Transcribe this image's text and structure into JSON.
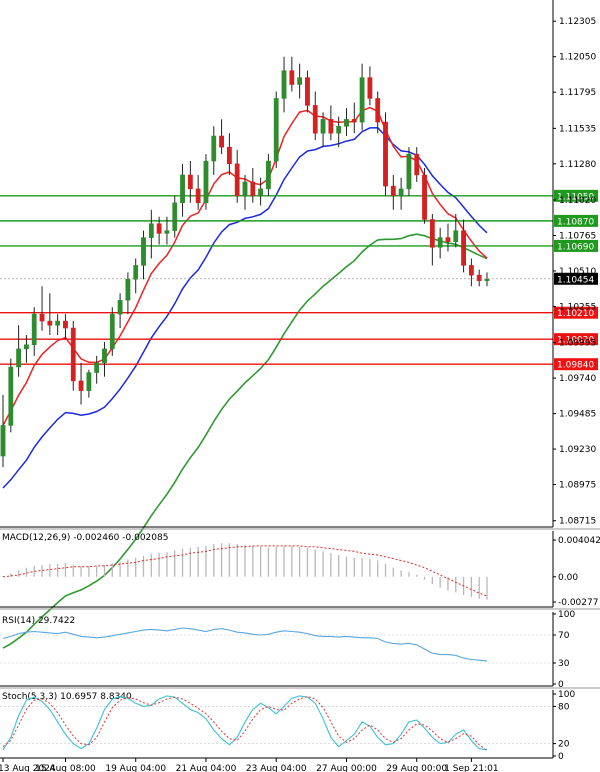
{
  "colors": {
    "bull": "#2e8b2e",
    "bear": "#d42020",
    "ma_red": "#ee2222",
    "ma_blue": "#1a2ae0",
    "ma_green": "#2f9a2f",
    "support": "#ee1111",
    "resistance": "#1f9a1f",
    "price_marker": "#000000",
    "macd_signal": "#ee2222",
    "macd_hist": "#b8b8b8",
    "rsi": "#5aa7e0",
    "stoch_main": "#3cc0d6",
    "stoch_signal": "#e33333"
  },
  "chart_data": [
    {
      "type": "candlestick",
      "pane": "price",
      "y_ticks": [
        "1.12305",
        "1.12050",
        "1.11795",
        "1.11535",
        "1.11280",
        "1.11020",
        "1.10765",
        "1.10510",
        "1.10255",
        "1.09995",
        "1.09740",
        "1.09485",
        "1.09230",
        "1.08975",
        "1.08715"
      ],
      "ylim": [
        1.0867,
        1.124
      ],
      "x_tick_labels": [
        "13 Aug 2024",
        "15 Aug 08:00",
        "19 Aug 04:00",
        "21 Aug 04:00",
        "23 Aug 04:00",
        "27 Aug 00:00",
        "29 Aug 00:00",
        "1 Sep 21:01"
      ],
      "current_price": "1.10454",
      "resistance_levels": [
        "1.11050",
        "1.10870",
        "1.10690"
      ],
      "support_levels": [
        "1.10210",
        "1.10020",
        "1.09840"
      ],
      "ohlc": [
        [
          1.0918,
          1.0962,
          1.091,
          1.094
        ],
        [
          1.094,
          1.0988,
          1.0935,
          1.0982
        ],
        [
          1.0982,
          1.1012,
          1.0975,
          1.0995
        ],
        [
          1.0995,
          1.1005,
          1.0985,
          1.0998
        ],
        [
          1.0998,
          1.1025,
          1.099,
          1.102
        ],
        [
          1.102,
          1.104,
          1.1008,
          1.1015
        ],
        [
          1.1015,
          1.1035,
          1.1005,
          1.1012
        ],
        [
          1.1012,
          1.102,
          1.1005,
          1.1015
        ],
        [
          1.1015,
          1.102,
          1.1002,
          1.101
        ],
        [
          1.101,
          1.1015,
          1.0965,
          1.0972
        ],
        [
          1.0972,
          1.0985,
          1.0955,
          1.0965
        ],
        [
          1.0965,
          1.098,
          1.096,
          1.0978
        ],
        [
          1.0978,
          1.099,
          1.097,
          1.0985
        ],
        [
          1.0985,
          1.1,
          1.0975,
          1.0995
        ],
        [
          1.0995,
          1.1025,
          1.099,
          1.102
        ],
        [
          1.102,
          1.1035,
          1.101,
          1.103
        ],
        [
          1.103,
          1.105,
          1.102,
          1.1045
        ],
        [
          1.1045,
          1.106,
          1.1035,
          1.1055
        ],
        [
          1.1055,
          1.108,
          1.1045,
          1.1075
        ],
        [
          1.1075,
          1.1095,
          1.106,
          1.1085
        ],
        [
          1.1085,
          1.109,
          1.107,
          1.1078
        ],
        [
          1.1078,
          1.109,
          1.107,
          1.108
        ],
        [
          1.108,
          1.1105,
          1.1075,
          1.11
        ],
        [
          1.11,
          1.1128,
          1.109,
          1.112
        ],
        [
          1.112,
          1.113,
          1.11,
          1.111
        ],
        [
          1.111,
          1.112,
          1.1095,
          1.11
        ],
        [
          1.11,
          1.1135,
          1.1095,
          1.113
        ],
        [
          1.113,
          1.1155,
          1.112,
          1.1148
        ],
        [
          1.1148,
          1.116,
          1.1135,
          1.114
        ],
        [
          1.114,
          1.115,
          1.112,
          1.1128
        ],
        [
          1.1128,
          1.1138,
          1.11,
          1.1105
        ],
        [
          1.1105,
          1.112,
          1.1095,
          1.1115
        ],
        [
          1.1115,
          1.1125,
          1.11,
          1.1105
        ],
        [
          1.1105,
          1.1118,
          1.1098,
          1.111
        ],
        [
          1.111,
          1.1135,
          1.1105,
          1.113
        ],
        [
          1.113,
          1.118,
          1.1125,
          1.1175
        ],
        [
          1.1175,
          1.1205,
          1.1165,
          1.1195
        ],
        [
          1.1195,
          1.1205,
          1.118,
          1.1185
        ],
        [
          1.1185,
          1.12,
          1.1175,
          1.119
        ],
        [
          1.119,
          1.1195,
          1.1165,
          1.117
        ],
        [
          1.117,
          1.118,
          1.1145,
          1.115
        ],
        [
          1.115,
          1.1165,
          1.114,
          1.116
        ],
        [
          1.116,
          1.117,
          1.1145,
          1.115
        ],
        [
          1.115,
          1.1162,
          1.114,
          1.1155
        ],
        [
          1.1155,
          1.1168,
          1.1148,
          1.116
        ],
        [
          1.116,
          1.1172,
          1.115,
          1.1158
        ],
        [
          1.1158,
          1.12,
          1.1152,
          1.119
        ],
        [
          1.119,
          1.1198,
          1.117,
          1.1175
        ],
        [
          1.1175,
          1.118,
          1.115,
          1.1158
        ],
        [
          1.1158,
          1.1165,
          1.1105,
          1.1112
        ],
        [
          1.1112,
          1.112,
          1.1095,
          1.1105
        ],
        [
          1.1105,
          1.1118,
          1.1095,
          1.111
        ],
        [
          1.111,
          1.114,
          1.1105,
          1.1135
        ],
        [
          1.1135,
          1.114,
          1.1115,
          1.112
        ],
        [
          1.112,
          1.1125,
          1.1085,
          1.1088
        ],
        [
          1.1088,
          1.1092,
          1.1055,
          1.1068
        ],
        [
          1.1068,
          1.1082,
          1.106,
          1.1075
        ],
        [
          1.1075,
          1.1085,
          1.1065,
          1.1072
        ],
        [
          1.1072,
          1.1092,
          1.1068,
          1.108
        ],
        [
          1.108,
          1.1088,
          1.105,
          1.1055
        ],
        [
          1.1055,
          1.106,
          1.104,
          1.1048
        ],
        [
          1.1048,
          1.1052,
          1.104,
          1.1044
        ],
        [
          1.1044,
          1.105,
          1.104,
          1.1045
        ]
      ]
    },
    {
      "type": "line",
      "pane": "macd",
      "title": "MACD(12,26,9) -0.002460 -0.002085",
      "y_ticks": [
        "0.004042",
        "0.00",
        "-0.00277"
      ],
      "ylim": [
        -0.0031,
        0.0046
      ],
      "histogram": [
        0.0001,
        0.0004,
        0.0007,
        0.001,
        0.0012,
        0.0013,
        0.0014,
        0.0014,
        0.0015,
        0.0013,
        0.0012,
        0.0012,
        0.0012,
        0.0013,
        0.0015,
        0.0017,
        0.0019,
        0.0021,
        0.0023,
        0.0025,
        0.0026,
        0.0027,
        0.0029,
        0.0031,
        0.0032,
        0.0033,
        0.0034,
        0.0036,
        0.0037,
        0.0037,
        0.0036,
        0.0035,
        0.0034,
        0.0033,
        0.0032,
        0.0033,
        0.0034,
        0.0034,
        0.0033,
        0.0032,
        0.003,
        0.0028,
        0.0026,
        0.0024,
        0.0022,
        0.0021,
        0.0021,
        0.002,
        0.0018,
        0.0014,
        0.001,
        0.0007,
        0.0005,
        0.0002,
        -0.0003,
        -0.0008,
        -0.0012,
        -0.0015,
        -0.0017,
        -0.002,
        -0.0022,
        -0.0024,
        -0.0025
      ],
      "signal": [
        0.0,
        0.0001,
        0.0002,
        0.0004,
        0.0006,
        0.0007,
        0.0008,
        0.0009,
        0.001,
        0.0011,
        0.0011,
        0.0011,
        0.0012,
        0.0012,
        0.0013,
        0.0014,
        0.0015,
        0.0016,
        0.0018,
        0.0019,
        0.002,
        0.0022,
        0.0023,
        0.0024,
        0.0026,
        0.0027,
        0.0028,
        0.003,
        0.0031,
        0.0032,
        0.0033,
        0.0033,
        0.0034,
        0.0034,
        0.0034,
        0.0034,
        0.0034,
        0.0034,
        0.0034,
        0.0033,
        0.0033,
        0.0032,
        0.0031,
        0.003,
        0.0029,
        0.0028,
        0.0026,
        0.0025,
        0.0024,
        0.0022,
        0.002,
        0.0018,
        0.0016,
        0.0013,
        0.001,
        0.0006,
        0.0002,
        -0.0002,
        -0.0006,
        -0.001,
        -0.0014,
        -0.0018,
        -0.0021
      ]
    },
    {
      "type": "line",
      "pane": "rsi",
      "title": "RSI(14) 29.7422",
      "y_ticks": [
        "100",
        "70",
        "30",
        "0"
      ],
      "ylim": [
        0,
        100
      ],
      "values": [
        65,
        68,
        72,
        74,
        75,
        74,
        73,
        72,
        74,
        71,
        68,
        67,
        66,
        67,
        69,
        71,
        73,
        75,
        77,
        78,
        77,
        76,
        78,
        80,
        79,
        77,
        75,
        78,
        79,
        77,
        74,
        73,
        71,
        70,
        71,
        74,
        76,
        75,
        74,
        72,
        69,
        68,
        68,
        67,
        68,
        67,
        66,
        66,
        65,
        60,
        58,
        57,
        58,
        56,
        50,
        44,
        42,
        42,
        41,
        37,
        35,
        34,
        33
      ]
    },
    {
      "type": "line",
      "pane": "stochastic",
      "title": "Stoch(5,3,3) 10.6957 8.8340",
      "y_ticks": [
        "100",
        "80",
        "20",
        "0"
      ],
      "ylim": [
        0,
        100
      ],
      "main": [
        10,
        30,
        65,
        90,
        95,
        88,
        75,
        55,
        35,
        20,
        12,
        20,
        45,
        75,
        92,
        96,
        93,
        85,
        80,
        82,
        92,
        97,
        95,
        85,
        75,
        70,
        60,
        42,
        28,
        18,
        30,
        55,
        75,
        85,
        78,
        68,
        80,
        93,
        97,
        95,
        85,
        60,
        30,
        15,
        25,
        35,
        55,
        48,
        30,
        18,
        20,
        35,
        55,
        58,
        45,
        30,
        20,
        22,
        35,
        42,
        25,
        12,
        10
      ],
      "signal": [
        15,
        25,
        50,
        75,
        90,
        92,
        85,
        70,
        50,
        32,
        20,
        18,
        30,
        55,
        78,
        90,
        94,
        92,
        86,
        82,
        86,
        92,
        95,
        92,
        85,
        77,
        68,
        55,
        40,
        28,
        25,
        40,
        60,
        75,
        80,
        75,
        74,
        85,
        92,
        96,
        92,
        78,
        55,
        32,
        22,
        28,
        42,
        50,
        42,
        28,
        22,
        28,
        42,
        52,
        50,
        40,
        28,
        22,
        28,
        36,
        32,
        18,
        9
      ]
    }
  ]
}
